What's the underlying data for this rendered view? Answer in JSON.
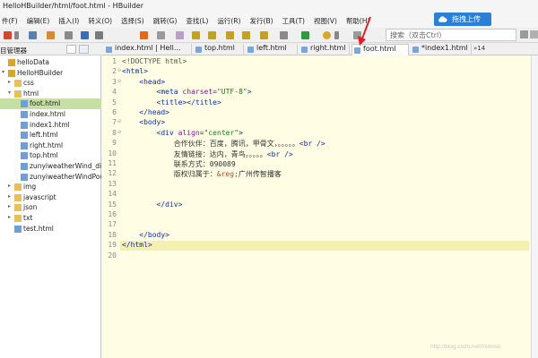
{
  "window": {
    "title": "HelloHBuilder/html/foot.html - HBuilder"
  },
  "menu": [
    "件(F)",
    "编辑(E)",
    "插入(I)",
    "转义(O)",
    "选择(S)",
    "跳转(G)",
    "查找(L)",
    "运行(R)",
    "发行(B)",
    "工具(T)",
    "视图(V)",
    "帮助(H)"
  ],
  "upload_button": {
    "label": "拖拽上传"
  },
  "search": {
    "placeholder": "搜索（双击Ctrl）"
  },
  "colors": {
    "accent": "#2b7fd6",
    "selected_row": "#c5dfa4",
    "editor_bg": "#fffde4",
    "current_line": "#f5f0b0",
    "arrow": "#e02020"
  },
  "panel": {
    "title": "目管理器",
    "tree": [
      {
        "label": "helloData",
        "level": 0,
        "icon": "project-icon",
        "arrow": ""
      },
      {
        "label": "HelloHBuilder",
        "level": 0,
        "icon": "project-icon",
        "arrow": "expanded"
      },
      {
        "label": "css",
        "level": 1,
        "icon": "folder-icon",
        "arrow": "collapsed"
      },
      {
        "label": "html",
        "level": 1,
        "icon": "folder-icon",
        "arrow": "expanded"
      },
      {
        "label": "foot.html",
        "level": 2,
        "icon": "html-file-icon",
        "arrow": "",
        "selected": true
      },
      {
        "label": "index.html",
        "level": 2,
        "icon": "html-file-icon",
        "arrow": ""
      },
      {
        "label": "index1.html",
        "level": 2,
        "icon": "html-file-icon",
        "arrow": ""
      },
      {
        "label": "left.html",
        "level": 2,
        "icon": "html-file-icon",
        "arrow": ""
      },
      {
        "label": "right.html",
        "level": 2,
        "icon": "html-file-icon",
        "arrow": ""
      },
      {
        "label": "top.html",
        "level": 2,
        "icon": "html-file-icon",
        "arrow": ""
      },
      {
        "label": "zunyiweatherWind_dir",
        "level": 2,
        "icon": "html-file-icon",
        "arrow": ""
      },
      {
        "label": "zunyiweatherWindPow",
        "level": 2,
        "icon": "html-file-icon",
        "arrow": ""
      },
      {
        "label": "img",
        "level": 1,
        "icon": "folder-icon",
        "arrow": "collapsed"
      },
      {
        "label": "javascript",
        "level": 1,
        "icon": "folder-icon",
        "arrow": "collapsed"
      },
      {
        "label": "json",
        "level": 1,
        "icon": "folder-icon",
        "arrow": "collapsed"
      },
      {
        "label": "txt",
        "level": 1,
        "icon": "folder-icon",
        "arrow": "collapsed"
      },
      {
        "label": "test.html",
        "level": 1,
        "icon": "html-file-icon",
        "arrow": ""
      }
    ]
  },
  "tabs": [
    {
      "label": "index.html | Hell...",
      "active": false
    },
    {
      "label": "top.html",
      "active": false
    },
    {
      "label": "left.html",
      "active": false
    },
    {
      "label": "right.html",
      "active": false
    },
    {
      "label": "foot.html",
      "active": true
    },
    {
      "label": "*index1.html",
      "active": false
    }
  ],
  "tab_overflow": "»14",
  "editor": {
    "current_line": 19,
    "lines": [
      {
        "n": "1",
        "fold": "",
        "segs": [
          [
            "doctype",
            "<!DOCTYPE html>"
          ]
        ]
      },
      {
        "n": "2",
        "fold": "⊖",
        "segs": [
          [
            "tag",
            "<html>"
          ]
        ]
      },
      {
        "n": "3",
        "fold": "⊖",
        "segs": [
          [
            "txt",
            "    "
          ],
          [
            "tag",
            "<head>"
          ]
        ]
      },
      {
        "n": "4",
        "fold": "",
        "segs": [
          [
            "txt",
            "        "
          ],
          [
            "tag",
            "<meta "
          ],
          [
            "attr",
            "charset"
          ],
          [
            "txt",
            "="
          ],
          [
            "str",
            "\"UTF-8\""
          ],
          [
            "tag",
            ">"
          ]
        ]
      },
      {
        "n": "5",
        "fold": "",
        "segs": [
          [
            "txt",
            "        "
          ],
          [
            "tag",
            "<title></title>"
          ]
        ]
      },
      {
        "n": "6",
        "fold": "",
        "segs": [
          [
            "txt",
            "    "
          ],
          [
            "tag",
            "</head>"
          ]
        ]
      },
      {
        "n": "7",
        "fold": "⊖",
        "segs": [
          [
            "txt",
            "    "
          ],
          [
            "tag",
            "<body>"
          ]
        ]
      },
      {
        "n": "8",
        "fold": "⊖",
        "segs": [
          [
            "txt",
            "        "
          ],
          [
            "tag",
            "<div "
          ],
          [
            "attr",
            "align"
          ],
          [
            "txt",
            "="
          ],
          [
            "str",
            "\"center\""
          ],
          [
            "tag",
            ">"
          ]
        ]
      },
      {
        "n": "9",
        "fold": "",
        "segs": [
          [
            "txt",
            "            合作伙伴：百度，腾讯，甲骨文，。。。。。"
          ],
          [
            "tag",
            "<br />"
          ]
        ]
      },
      {
        "n": "10",
        "fold": "",
        "segs": [
          [
            "txt",
            "            友情链接：达内，青鸟。。。。。"
          ],
          [
            "tag",
            "<br />"
          ]
        ]
      },
      {
        "n": "11",
        "fold": "",
        "segs": [
          [
            "txt",
            "            联系方式：090089"
          ]
        ]
      },
      {
        "n": "12",
        "fold": "",
        "segs": [
          [
            "txt",
            "            版权归属于："
          ],
          [
            "ent",
            "&reg;"
          ],
          [
            "txt",
            "广州传智播客"
          ]
        ]
      },
      {
        "n": "13",
        "fold": "",
        "segs": []
      },
      {
        "n": "14",
        "fold": "",
        "segs": []
      },
      {
        "n": "15",
        "fold": "",
        "segs": [
          [
            "txt",
            "        "
          ],
          [
            "tag",
            "</div>"
          ]
        ]
      },
      {
        "n": "16",
        "fold": "",
        "segs": []
      },
      {
        "n": "17",
        "fold": "",
        "segs": []
      },
      {
        "n": "18",
        "fold": "",
        "segs": [
          [
            "txt",
            "    "
          ],
          [
            "tag",
            "</body>"
          ]
        ]
      },
      {
        "n": "19",
        "fold": "",
        "segs": [
          [
            "tag",
            "</html>"
          ]
        ]
      },
      {
        "n": "20",
        "fold": "",
        "segs": []
      }
    ]
  },
  "watermark": "http://blog.csdn.net/minrest"
}
